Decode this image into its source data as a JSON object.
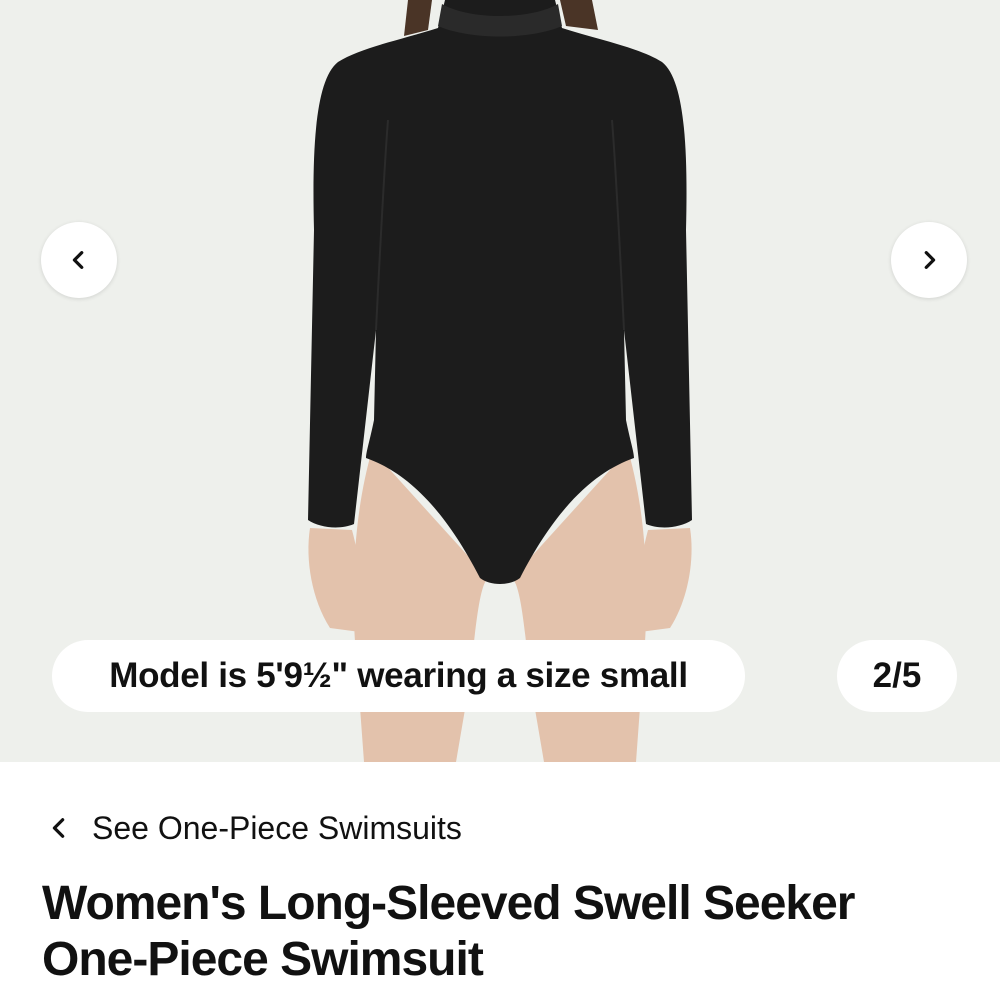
{
  "gallery": {
    "caption": "Model is 5'9½\" wearing a size small",
    "counter": "2/5",
    "prev_icon": "chevron-left-icon",
    "next_icon": "chevron-right-icon",
    "image_subject": "model wearing long-sleeved black mock-neck one-piece swimsuit"
  },
  "breadcrumb": {
    "label": "See One-Piece Swimsuits",
    "icon": "chevron-left-icon"
  },
  "product": {
    "title": "Women's Long-Sleeved Swell Seeker One-Piece Swimsuit"
  },
  "colors": {
    "gallery_bg": "#eef0ec",
    "swimsuit": "#1c1c1c",
    "skin": "#e3c2ac",
    "text": "#111111"
  }
}
